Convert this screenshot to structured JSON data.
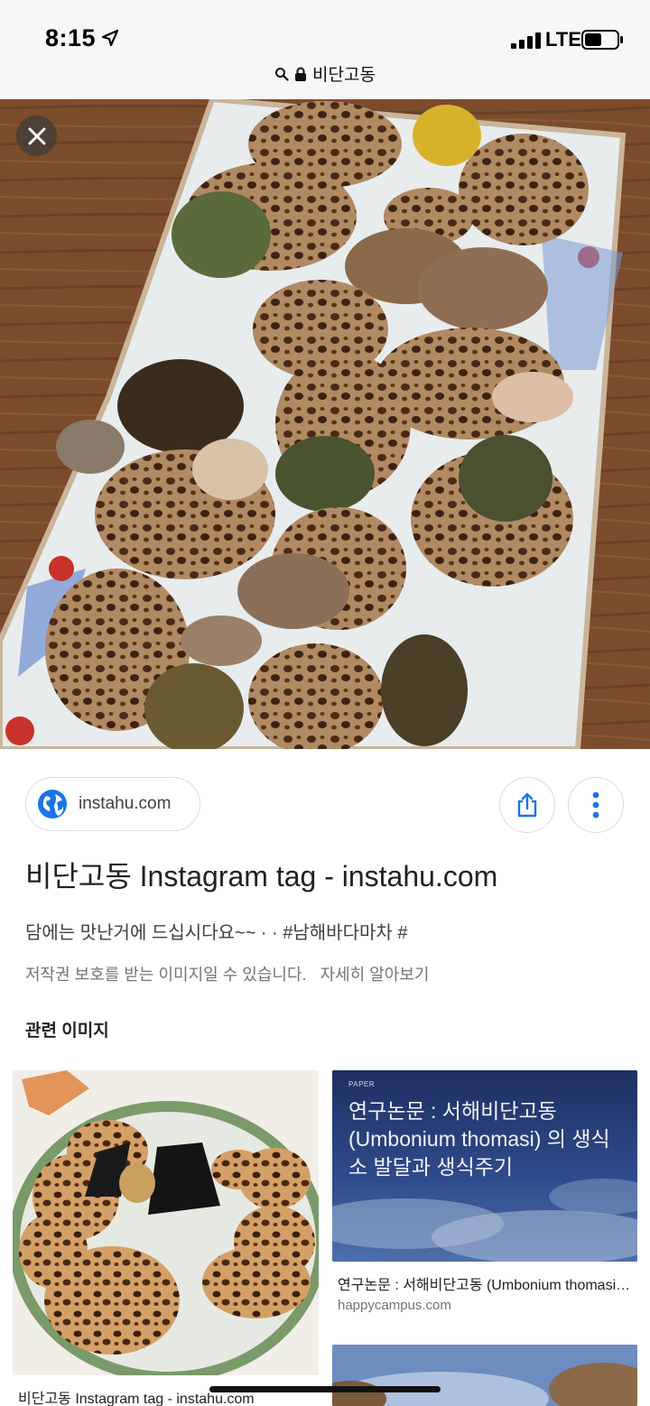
{
  "status_bar": {
    "time": "8:15",
    "carrier": "LTE",
    "url": "비단고동"
  },
  "hero": {
    "close_icon": "close-icon"
  },
  "source": {
    "domain": "instahu.com",
    "globe_color": "#1a73e8"
  },
  "result": {
    "title": "비단고동 Instagram tag - instahu.com",
    "snippet": "담에는 맛난거에 드십시다요~~  ·  · #남해바다마차 #",
    "copyright": "저작권 보호를 받는 이미지일 수 있습니다.",
    "learn_more": "자세히 알아보기"
  },
  "related": {
    "heading": "관련 이미지",
    "cards": [
      {
        "caption": "비단고동 Instagram tag - instahu.com"
      },
      {
        "paper_tag": "PAPER",
        "paper_title": "연구논문 : 서해비단고동 (Umbonium thomasi) 의 생식소 발달과 생식주기",
        "caption": "연구논문 : 서해비단고동 (Umbonium thomasi) 의 생식소 발달과 생식주기",
        "domain": "happycampus.com"
      }
    ]
  }
}
